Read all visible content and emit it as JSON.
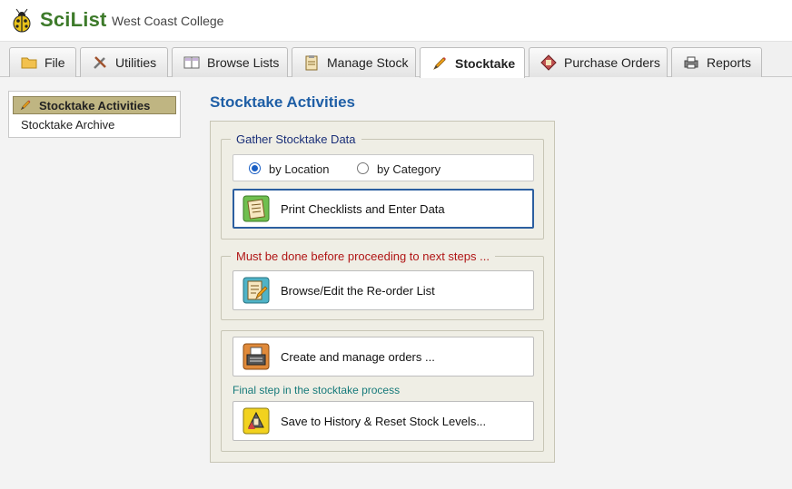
{
  "header": {
    "brand": "SciList",
    "college": "West Coast College"
  },
  "tabs": [
    {
      "label": "File",
      "icon": "folder-icon"
    },
    {
      "label": "Utilities",
      "icon": "tools-icon"
    },
    {
      "label": "Browse Lists",
      "icon": "book-icon"
    },
    {
      "label": "Manage Stock",
      "icon": "clipboard-icon"
    },
    {
      "label": "Stocktake",
      "icon": "pencil-icon",
      "active": true
    },
    {
      "label": "Purchase Orders",
      "icon": "order-icon"
    },
    {
      "label": "Reports",
      "icon": "printer-icon"
    }
  ],
  "sidebar": {
    "items": [
      {
        "label": "Stocktake Activities",
        "active": true
      },
      {
        "label": "Stocktake Archive"
      }
    ]
  },
  "main": {
    "title": "Stocktake Activities",
    "gather": {
      "legend": "Gather Stocktake Data",
      "radio_location": "by Location",
      "radio_category": "by Category",
      "print_button": "Print Checklists and Enter Data"
    },
    "reorder": {
      "legend": "Must be done before proceeding to next steps ...",
      "button": "Browse/Edit the Re-order List"
    },
    "orders": {
      "button": "Create and manage orders ...",
      "final_note": "Final step in the stocktake process",
      "save_button": "Save to History & Reset Stock Levels..."
    }
  },
  "colors": {
    "brand": "#3d7a2a",
    "title": "#1f5fa6",
    "warning": "#b01515",
    "note": "#167a7a",
    "sidebar_active": "#bfb582"
  }
}
